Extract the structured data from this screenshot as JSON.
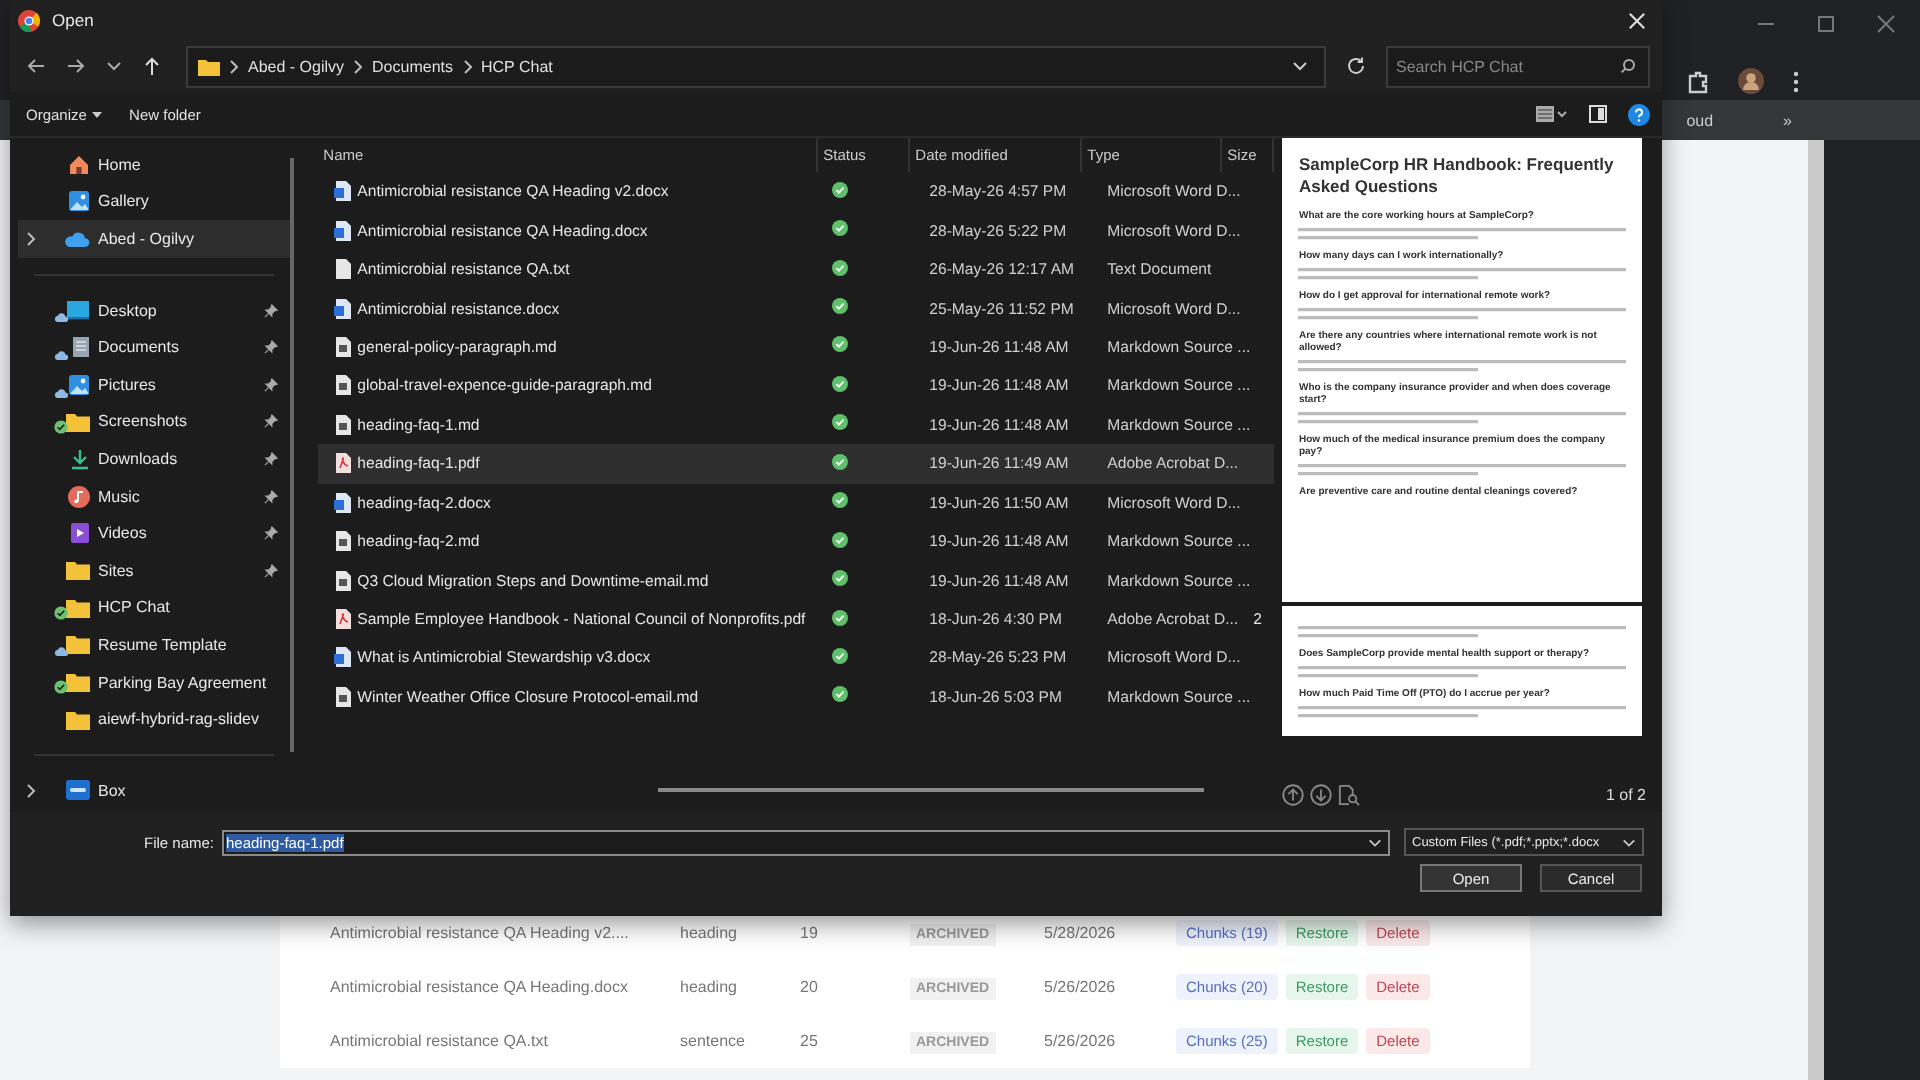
{
  "browser": {
    "bookmark_text": "oud",
    "more_bookmarks": "»"
  },
  "background_table": {
    "rows": [
      {
        "name": "Antimicrobial resistance QA Heading v2....",
        "strategy": "heading",
        "count": "19",
        "status": "ARCHIVED",
        "date": "5/28/2026",
        "chunks": "Chunks (19)",
        "restore": "Restore",
        "delete": "Delete"
      },
      {
        "name": "Antimicrobial resistance QA Heading.docx",
        "strategy": "heading",
        "count": "20",
        "status": "ARCHIVED",
        "date": "5/26/2026",
        "chunks": "Chunks (20)",
        "restore": "Restore",
        "delete": "Delete"
      },
      {
        "name": "Antimicrobial resistance QA.txt",
        "strategy": "sentence",
        "count": "25",
        "status": "ARCHIVED",
        "date": "5/26/2026",
        "chunks": "Chunks (25)",
        "restore": "Restore",
        "delete": "Delete"
      }
    ]
  },
  "window": {
    "title": "Open"
  },
  "nav": {
    "breadcrumbs": [
      "Abed - Ogilvy",
      "Documents",
      "HCP Chat"
    ],
    "search": {
      "placeholder": "Search HCP Chat"
    }
  },
  "toolbar": {
    "organize": "Organize",
    "new_folder": "New folder"
  },
  "sidebar": {
    "sections": [
      {
        "items": [
          {
            "label": "Home",
            "kind": "home",
            "expandable": false,
            "pinned": false,
            "online_only": false,
            "synced": false,
            "selected": false
          },
          {
            "label": "Gallery",
            "kind": "gallery",
            "expandable": false,
            "pinned": false,
            "online_only": false,
            "synced": false,
            "selected": false
          },
          {
            "label": "Abed - Ogilvy",
            "kind": "cloud",
            "expandable": true,
            "pinned": false,
            "online_only": false,
            "synced": false,
            "selected": true
          }
        ]
      },
      {
        "items": [
          {
            "label": "Desktop",
            "kind": "desktop",
            "expandable": false,
            "pinned": true,
            "online_only": true,
            "synced": false,
            "selected": false
          },
          {
            "label": "Documents",
            "kind": "documents",
            "expandable": false,
            "pinned": true,
            "online_only": true,
            "synced": false,
            "selected": false
          },
          {
            "label": "Pictures",
            "kind": "gallery",
            "expandable": false,
            "pinned": true,
            "online_only": true,
            "synced": false,
            "selected": false
          },
          {
            "label": "Screenshots",
            "kind": "folder",
            "expandable": false,
            "pinned": true,
            "online_only": false,
            "synced": true,
            "selected": false
          },
          {
            "label": "Downloads",
            "kind": "downloads",
            "expandable": false,
            "pinned": true,
            "online_only": false,
            "synced": false,
            "selected": false
          },
          {
            "label": "Music",
            "kind": "music",
            "expandable": false,
            "pinned": true,
            "online_only": false,
            "synced": false,
            "selected": false
          },
          {
            "label": "Videos",
            "kind": "videos",
            "expandable": false,
            "pinned": true,
            "online_only": false,
            "synced": false,
            "selected": false
          },
          {
            "label": "Sites",
            "kind": "folder",
            "expandable": false,
            "pinned": true,
            "online_only": false,
            "synced": false,
            "selected": false
          },
          {
            "label": "HCP Chat",
            "kind": "folder",
            "expandable": false,
            "pinned": false,
            "online_only": false,
            "synced": true,
            "selected": false
          },
          {
            "label": "Resume Template",
            "kind": "folder",
            "expandable": false,
            "pinned": false,
            "online_only": true,
            "synced": false,
            "selected": false
          },
          {
            "label": "Parking Bay Agreement",
            "kind": "folder",
            "expandable": false,
            "pinned": false,
            "online_only": false,
            "synced": true,
            "selected": false
          },
          {
            "label": "aiewf-hybrid-rag-slidev",
            "kind": "folder",
            "expandable": false,
            "pinned": false,
            "online_only": false,
            "synced": false,
            "selected": false
          }
        ]
      },
      {
        "items": [
          {
            "label": "Box",
            "kind": "box",
            "expandable": true,
            "pinned": false,
            "online_only": false,
            "synced": false,
            "selected": false
          }
        ]
      }
    ]
  },
  "files": {
    "columns": [
      "Name",
      "Status",
      "Date modified",
      "Type",
      "Size"
    ],
    "rows": [
      {
        "name": "Antimicrobial resistance QA Heading v2.docx",
        "kind": "docx",
        "synced": true,
        "date": "28-May-26 4:57 PM",
        "type": "Microsoft Word D...",
        "selected": false
      },
      {
        "name": "Antimicrobial resistance QA Heading.docx",
        "kind": "docx",
        "synced": true,
        "date": "28-May-26 5:22 PM",
        "type": "Microsoft Word D...",
        "selected": false
      },
      {
        "name": "Antimicrobial resistance QA.txt",
        "kind": "txt",
        "synced": true,
        "date": "26-May-26 12:17 AM",
        "type": "Text Document",
        "selected": false
      },
      {
        "name": "Antimicrobial resistance.docx",
        "kind": "docx",
        "synced": true,
        "date": "25-May-26 11:52 PM",
        "type": "Microsoft Word D...",
        "selected": false
      },
      {
        "name": "general-policy-paragraph.md",
        "kind": "md",
        "synced": true,
        "date": "19-Jun-26 11:48 AM",
        "type": "Markdown Source ...",
        "selected": false
      },
      {
        "name": "global-travel-expence-guide-paragraph.md",
        "kind": "md",
        "synced": true,
        "date": "19-Jun-26 11:48 AM",
        "type": "Markdown Source ...",
        "selected": false
      },
      {
        "name": "heading-faq-1.md",
        "kind": "md",
        "synced": true,
        "date": "19-Jun-26 11:48 AM",
        "type": "Markdown Source ...",
        "selected": false
      },
      {
        "name": "heading-faq-1.pdf",
        "kind": "pdf",
        "synced": true,
        "date": "19-Jun-26 11:49 AM",
        "type": "Adobe Acrobat D...",
        "selected": true
      },
      {
        "name": "heading-faq-2.docx",
        "kind": "docx",
        "synced": true,
        "date": "19-Jun-26 11:50 AM",
        "type": "Microsoft Word D...",
        "selected": false
      },
      {
        "name": "heading-faq-2.md",
        "kind": "md",
        "synced": true,
        "date": "19-Jun-26 11:48 AM",
        "type": "Markdown Source ...",
        "selected": false
      },
      {
        "name": "Q3 Cloud Migration Steps and Downtime-email.md",
        "kind": "md",
        "synced": true,
        "date": "19-Jun-26 11:48 AM",
        "type": "Markdown Source ...",
        "selected": false
      },
      {
        "name": "Sample Employee Handbook - National Council of Nonprofits.pdf",
        "kind": "pdf",
        "synced": true,
        "date": "18-Jun-26 4:30 PM",
        "type": "Adobe Acrobat D...",
        "size": "2",
        "selected": false
      },
      {
        "name": "What is Antimicrobial Stewardship v3.docx",
        "kind": "docx",
        "synced": true,
        "date": "28-May-26 5:23 PM",
        "type": "Microsoft Word D...",
        "selected": false
      },
      {
        "name": "Winter Weather Office Closure Protocol-email.md",
        "kind": "md",
        "synced": true,
        "date": "18-Jun-26 5:03 PM",
        "type": "Markdown Source ...",
        "selected": false
      }
    ]
  },
  "preview": {
    "pages": [
      {
        "title": "SampleCorp HR Handbook: Frequently Asked Questions",
        "sections": [
          {
            "kind": "question",
            "heading": "What are the core working hours at SampleCorp?"
          },
          {
            "kind": "question",
            "heading": "How many days can I work internationally?"
          },
          {
            "kind": "question",
            "heading": "How do I get approval for international remote work?"
          },
          {
            "kind": "question",
            "heading": "Are there any countries where international remote work is not allowed?"
          },
          {
            "kind": "question",
            "heading": "Who is the company insurance provider and when does coverage start?"
          },
          {
            "kind": "question",
            "heading": "How much of the medical insurance premium does the company pay?"
          },
          {
            "kind": "heading_only",
            "heading": "Are preventive care and routine dental cleanings covered?"
          }
        ]
      },
      {
        "sections": [
          {
            "kind": "paragraph_only"
          },
          {
            "kind": "question",
            "heading": "Does SampleCorp provide mental health support or therapy?"
          },
          {
            "kind": "question",
            "heading": "How much Paid Time Off (PTO) do I accrue per year?"
          }
        ]
      }
    ],
    "page_counter": "1 of 2"
  },
  "footer": {
    "file_name_label": "File name:",
    "file_name": "heading-faq-1.pdf",
    "filter": "Custom Files (*.pdf;*.pptx;*.docx",
    "open": "Open",
    "cancel": "Cancel"
  }
}
